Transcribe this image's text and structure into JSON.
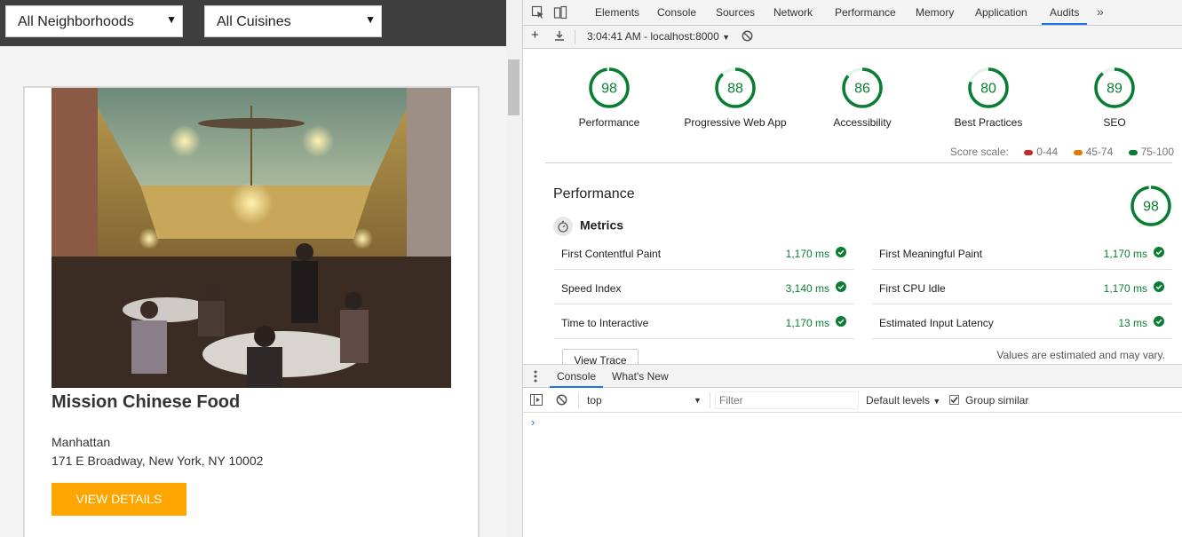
{
  "filters": {
    "neighborhood": "All Neighborhoods",
    "cuisine": "All Cuisines"
  },
  "restaurant": {
    "name": "Mission Chinese Food",
    "neighborhood": "Manhattan",
    "address": "171 E Broadway, New York, NY 10002",
    "button_label": "VIEW DETAILS"
  },
  "devtools": {
    "tabs": [
      "Elements",
      "Console",
      "Sources",
      "Network",
      "Performance",
      "Memory",
      "Application",
      "Audits"
    ],
    "active_tab": "Audits",
    "more": "»",
    "report_selector": "3:04:41 AM - localhost:8000",
    "audits": {
      "categories": [
        {
          "label": "Performance",
          "score": "98"
        },
        {
          "label": "Progressive Web App",
          "score": "88"
        },
        {
          "label": "Accessibility",
          "score": "86"
        },
        {
          "label": "Best Practices",
          "score": "80"
        },
        {
          "label": "SEO",
          "score": "89"
        }
      ],
      "score_scale": {
        "label": "Score scale:",
        "ranges": [
          {
            "range": "0-44",
            "color": "#c62828"
          },
          {
            "range": "45-74",
            "color": "#e67700"
          },
          {
            "range": "75-100",
            "color": "#0a7d33"
          }
        ]
      },
      "performance_title": "Performance",
      "performance_score": "98",
      "metrics_heading": "Metrics",
      "metrics_left": [
        {
          "name": "First Contentful Paint",
          "value": "1,170 ms"
        },
        {
          "name": "Speed Index",
          "value": "3,140 ms"
        },
        {
          "name": "Time to Interactive",
          "value": "1,170 ms"
        }
      ],
      "metrics_right": [
        {
          "name": "First Meaningful Paint",
          "value": "1,170 ms"
        },
        {
          "name": "First CPU Idle",
          "value": "1,170 ms"
        },
        {
          "name": "Estimated Input Latency",
          "value": "13 ms"
        }
      ],
      "view_trace_label": "View Trace",
      "estimate_note": "Values are estimated and may vary."
    },
    "drawer": {
      "tabs": [
        "Console",
        "What's New"
      ],
      "context": "top",
      "filter_placeholder": "Filter",
      "levels": "Default levels",
      "group_similar": "Group similar",
      "prompt": "›"
    },
    "colors": {
      "pass": "#0a7d33",
      "accent": "#1a73e8"
    }
  }
}
